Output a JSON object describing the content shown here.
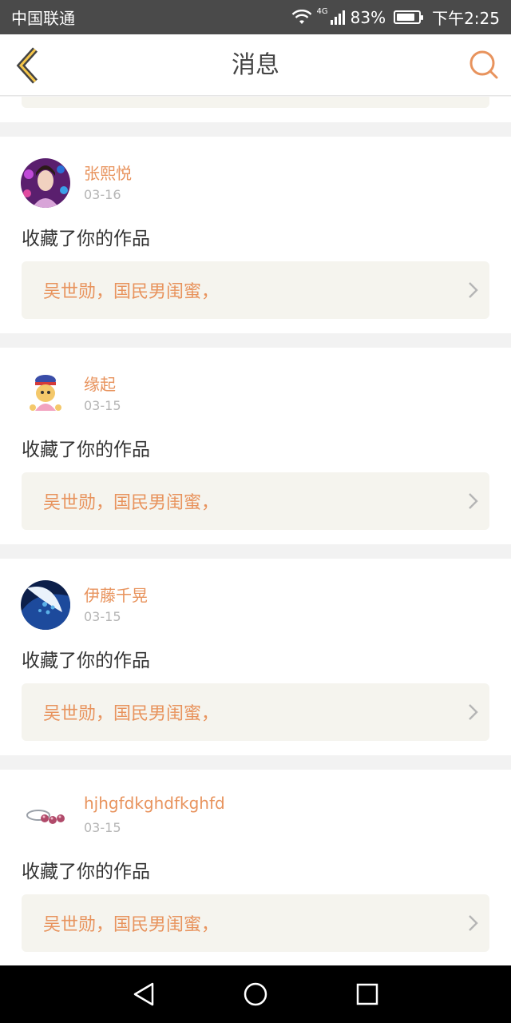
{
  "status_bar": {
    "carrier": "中国联通",
    "network": "4G",
    "battery_percent": "83%",
    "battery_level": 0.83,
    "time": "下午2:25"
  },
  "header": {
    "title": "消息",
    "back_icon": "chevron-left-icon",
    "search_icon": "search-icon",
    "accent_color": "#e8935d"
  },
  "messages": [
    {
      "user": "张熙悦",
      "date": "03-16",
      "action": "收藏了你的作品",
      "work": "吴世勋，国民男闺蜜，",
      "avatar": "portrait-avatar"
    },
    {
      "user": "缘起",
      "date": "03-15",
      "action": "收藏了你的作品",
      "work": "吴世勋，国民男闺蜜，",
      "avatar": "cartoon-avatar"
    },
    {
      "user": "伊藤千晃",
      "date": "03-15",
      "action": "收藏了你的作品",
      "work": "吴世勋，国民男闺蜜，",
      "avatar": "abstract-blue-avatar"
    },
    {
      "user": "hjhgfdkghdfkghfd",
      "date": "03-15",
      "action": "收藏了你的作品",
      "work": "吴世勋，国民男闺蜜，",
      "avatar": "ring-avatar"
    }
  ],
  "nav_bar": {
    "back": "triangle-back-icon",
    "home": "circle-home-icon",
    "recents": "square-recents-icon"
  }
}
